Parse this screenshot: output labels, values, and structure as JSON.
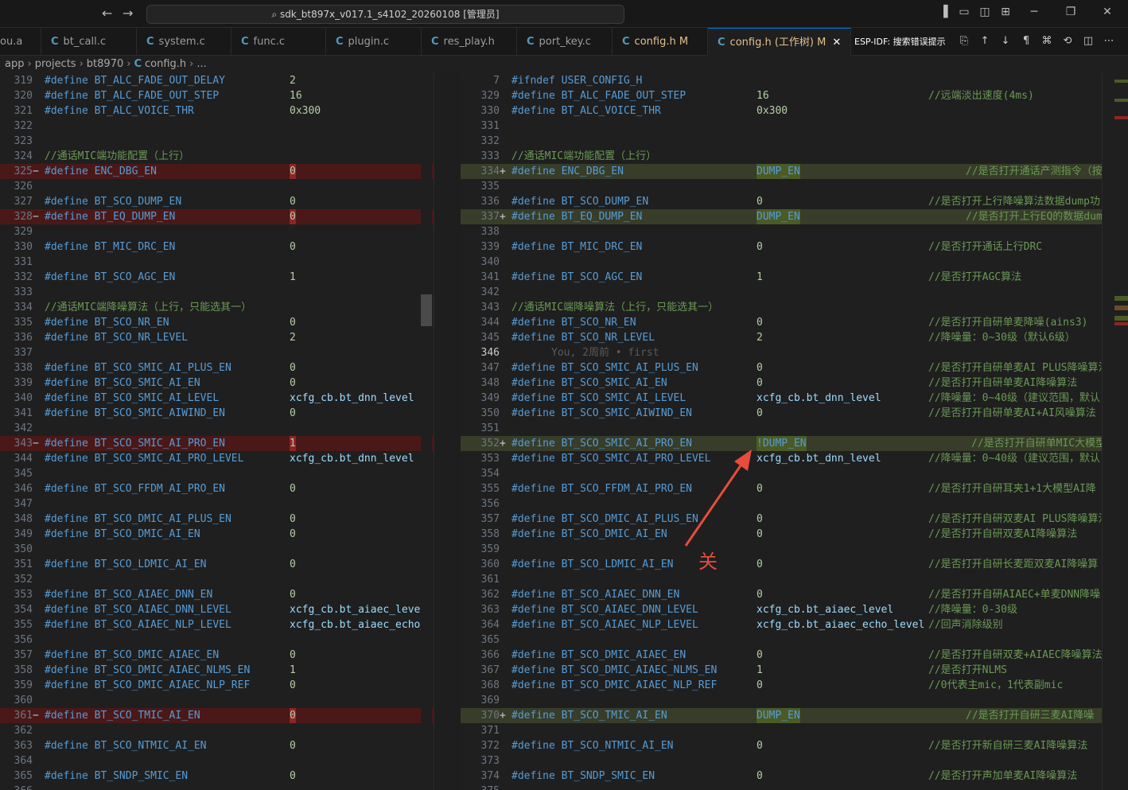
{
  "titlebar": {
    "back_icon": "arrow-left-icon",
    "forward_icon": "arrow-right-icon",
    "search_text": "sdk_bt897x_v017.1_s4102_20260108 [管理员]",
    "controls": [
      "layout-sidebar-icon",
      "layout-panel-icon",
      "layout-split-icon",
      "layout-grid-icon",
      "minimize-icon",
      "restore-icon",
      "close-icon"
    ]
  },
  "tabs": [
    {
      "label": "ou.a",
      "icon": "",
      "mod": "",
      "active": false
    },
    {
      "label": "bt_call.c",
      "icon": "C",
      "mod": "",
      "active": false
    },
    {
      "label": "system.c",
      "icon": "C",
      "mod": "",
      "active": false
    },
    {
      "label": "func.c",
      "icon": "C",
      "mod": "",
      "active": false
    },
    {
      "label": "plugin.c",
      "icon": "C",
      "mod": "",
      "active": false
    },
    {
      "label": "res_play.h",
      "icon": "C",
      "mod": "",
      "active": false
    },
    {
      "label": "port_key.c",
      "icon": "C",
      "mod": "",
      "active": false
    },
    {
      "label": "config.h",
      "icon": "C",
      "mod": "M",
      "active": false
    },
    {
      "label": "config.h (工作树)",
      "icon": "C",
      "mod": "M",
      "active": true
    }
  ],
  "tab_tools": {
    "label": "ESP-IDF: 搜索错误提示"
  },
  "breadcrumb": [
    "app",
    "projects",
    "bt8970",
    "config.h",
    "..."
  ],
  "colors": {
    "deleted": "#4b1818",
    "added": "#373d29",
    "keyword": "#569cd6",
    "comment": "#6a9955",
    "number": "#b5cea8",
    "annotation": "#e74c3c"
  },
  "left_lines": [
    {
      "n": "319",
      "t": "d",
      "name": "BT_ALC_FADE_OUT_DELAY",
      "val": "2"
    },
    {
      "n": "320",
      "t": "d",
      "name": "BT_ALC_FADE_OUT_STEP",
      "val": "16"
    },
    {
      "n": "321",
      "t": "d",
      "name": "BT_ALC_VOICE_THR",
      "val": "0x300"
    },
    {
      "n": "322",
      "t": "e"
    },
    {
      "n": "323",
      "t": "e"
    },
    {
      "n": "324",
      "t": "c",
      "text": "//通话MIC端功能配置（上行）"
    },
    {
      "n": "325",
      "t": "d",
      "name": "ENC_DBG_EN",
      "val": "0",
      "diff": "del"
    },
    {
      "n": "326",
      "t": "e"
    },
    {
      "n": "327",
      "t": "d",
      "name": "BT_SCO_DUMP_EN",
      "val": "0"
    },
    {
      "n": "328",
      "t": "d",
      "name": "BT_EQ_DUMP_EN",
      "val": "0",
      "diff": "del"
    },
    {
      "n": "329",
      "t": "e"
    },
    {
      "n": "330",
      "t": "d",
      "name": "BT_MIC_DRC_EN",
      "val": "0"
    },
    {
      "n": "331",
      "t": "e"
    },
    {
      "n": "332",
      "t": "d",
      "name": "BT_SCO_AGC_EN",
      "val": "1"
    },
    {
      "n": "333",
      "t": "e"
    },
    {
      "n": "334",
      "t": "c",
      "text": "//通话MIC端降噪算法（上行，只能选其一）"
    },
    {
      "n": "335",
      "t": "d",
      "name": "BT_SCO_NR_EN",
      "val": "0"
    },
    {
      "n": "336",
      "t": "d",
      "name": "BT_SCO_NR_LEVEL",
      "val": "2"
    },
    {
      "n": "337",
      "t": "e"
    },
    {
      "n": "338",
      "t": "d",
      "name": "BT_SCO_SMIC_AI_PLUS_EN",
      "val": "0"
    },
    {
      "n": "339",
      "t": "d",
      "name": "BT_SCO_SMIC_AI_EN",
      "val": "0"
    },
    {
      "n": "340",
      "t": "d",
      "name": "BT_SCO_SMIC_AI_LEVEL",
      "val": "xcfg_cb.bt_dnn_level"
    },
    {
      "n": "341",
      "t": "d",
      "name": "BT_SCO_SMIC_AIWIND_EN",
      "val": "0"
    },
    {
      "n": "342",
      "t": "e"
    },
    {
      "n": "343",
      "t": "d",
      "name": "BT_SCO_SMIC_AI_PRO_EN",
      "val": "1",
      "diff": "del"
    },
    {
      "n": "344",
      "t": "d",
      "name": "BT_SCO_SMIC_AI_PRO_LEVEL",
      "val": "xcfg_cb.bt_dnn_level"
    },
    {
      "n": "345",
      "t": "e"
    },
    {
      "n": "346",
      "t": "d",
      "name": "BT_SCO_FFDM_AI_PRO_EN",
      "val": "0"
    },
    {
      "n": "347",
      "t": "e"
    },
    {
      "n": "348",
      "t": "d",
      "name": "BT_SCO_DMIC_AI_PLUS_EN",
      "val": "0"
    },
    {
      "n": "349",
      "t": "d",
      "name": "BT_SCO_DMIC_AI_EN",
      "val": "0"
    },
    {
      "n": "350",
      "t": "e"
    },
    {
      "n": "351",
      "t": "d",
      "name": "BT_SCO_LDMIC_AI_EN",
      "val": "0"
    },
    {
      "n": "352",
      "t": "e"
    },
    {
      "n": "353",
      "t": "d",
      "name": "BT_SCO_AIAEC_DNN_EN",
      "val": "0"
    },
    {
      "n": "354",
      "t": "d",
      "name": "BT_SCO_AIAEC_DNN_LEVEL",
      "val": "xcfg_cb.bt_aiaec_level"
    },
    {
      "n": "355",
      "t": "d",
      "name": "BT_SCO_AIAEC_NLP_LEVEL",
      "val": "xcfg_cb.bt_aiaec_echo_l"
    },
    {
      "n": "356",
      "t": "e"
    },
    {
      "n": "357",
      "t": "d",
      "name": "BT_SCO_DMIC_AIAEC_EN",
      "val": "0"
    },
    {
      "n": "358",
      "t": "d",
      "name": "BT_SCO_DMIC_AIAEC_NLMS_EN",
      "val": "1"
    },
    {
      "n": "359",
      "t": "d",
      "name": "BT_SCO_DMIC_AIAEC_NLP_REF",
      "val": "0"
    },
    {
      "n": "360",
      "t": "e"
    },
    {
      "n": "361",
      "t": "d",
      "name": "BT_SCO_TMIC_AI_EN",
      "val": "0",
      "diff": "del"
    },
    {
      "n": "362",
      "t": "e"
    },
    {
      "n": "363",
      "t": "d",
      "name": "BT_SCO_NTMIC_AI_EN",
      "val": "0"
    },
    {
      "n": "364",
      "t": "e"
    },
    {
      "n": "365",
      "t": "d",
      "name": "BT_SNDP_SMIC_EN",
      "val": "0"
    },
    {
      "n": "366",
      "t": "e"
    }
  ],
  "right_lines": [
    {
      "n": "7",
      "t": "raw",
      "text": "#ifndef USER_CONFIG_H"
    },
    {
      "n": "329",
      "t": "d",
      "name": "BT_ALC_FADE_OUT_STEP",
      "val": "16",
      "cmt": "//远端淡出速度(4ms)"
    },
    {
      "n": "330",
      "t": "d",
      "name": "BT_ALC_VOICE_THR",
      "val": "0x300"
    },
    {
      "n": "331",
      "t": "e"
    },
    {
      "n": "332",
      "t": "e"
    },
    {
      "n": "333",
      "t": "c",
      "text": "//通话MIC端功能配置（上行）"
    },
    {
      "n": "334",
      "t": "d",
      "name": "ENC_DBG_EN",
      "val": "DUMP_EN",
      "cmt": "//是否打开通话产测指令（按",
      "diff": "add",
      "cmtAt": "far"
    },
    {
      "n": "335",
      "t": "e"
    },
    {
      "n": "336",
      "t": "d",
      "name": "BT_SCO_DUMP_EN",
      "val": "0",
      "cmt": "//是否打开上行降噪算法数据dump功"
    },
    {
      "n": "337",
      "t": "d",
      "name": "BT_EQ_DUMP_EN",
      "val": "DUMP_EN",
      "cmt": "//是否打开上行EQ的数据dump",
      "diff": "add",
      "cmtAt": "far"
    },
    {
      "n": "338",
      "t": "e"
    },
    {
      "n": "339",
      "t": "d",
      "name": "BT_MIC_DRC_EN",
      "val": "0",
      "cmt": "//是否打开通话上行DRC"
    },
    {
      "n": "340",
      "t": "e"
    },
    {
      "n": "341",
      "t": "d",
      "name": "BT_SCO_AGC_EN",
      "val": "1",
      "cmt": "//是否打开AGC算法"
    },
    {
      "n": "342",
      "t": "e"
    },
    {
      "n": "343",
      "t": "c",
      "text": "//通话MIC端降噪算法（上行，只能选其一）"
    },
    {
      "n": "344",
      "t": "d",
      "name": "BT_SCO_NR_EN",
      "val": "0",
      "cmt": "//是否打开自研单麦降噪(ains3)"
    },
    {
      "n": "345",
      "t": "d",
      "name": "BT_SCO_NR_LEVEL",
      "val": "2",
      "cmt": "//降噪量：0~30级（默认6级）"
    },
    {
      "n": "346",
      "t": "blame",
      "text": "You, 2周前 • first",
      "cur": true
    },
    {
      "n": "347",
      "t": "d",
      "name": "BT_SCO_SMIC_AI_PLUS_EN",
      "val": "0",
      "cmt": "//是否打开自研单麦AI PLUS降噪算法"
    },
    {
      "n": "348",
      "t": "d",
      "name": "BT_SCO_SMIC_AI_EN",
      "val": "0",
      "cmt": "//是否打开自研单麦AI降噪算法"
    },
    {
      "n": "349",
      "t": "d",
      "name": "BT_SCO_SMIC_AI_LEVEL",
      "val": "xcfg_cb.bt_dnn_level",
      "cmt": "//降噪量：0~40级（建议范围，默认"
    },
    {
      "n": "350",
      "t": "d",
      "name": "BT_SCO_SMIC_AIWIND_EN",
      "val": "0",
      "cmt": "//是否打开自研单麦AI+AI风噪算法"
    },
    {
      "n": "351",
      "t": "e"
    },
    {
      "n": "352",
      "t": "d",
      "name": "BT_SCO_SMIC_AI_PRO_EN",
      "val": "!DUMP_EN",
      "cmt": "//是否打开自研单MIC大模型",
      "diff": "add",
      "cmtAt": "far2"
    },
    {
      "n": "353",
      "t": "d",
      "name": "BT_SCO_SMIC_AI_PRO_LEVEL",
      "val": "xcfg_cb.bt_dnn_level",
      "cmt": "//降噪量：0~40级（建议范围，默认"
    },
    {
      "n": "354",
      "t": "e"
    },
    {
      "n": "355",
      "t": "d",
      "name": "BT_SCO_FFDM_AI_PRO_EN",
      "val": "0",
      "cmt": "//是否打开自研耳夹1+1大模型AI降"
    },
    {
      "n": "356",
      "t": "e"
    },
    {
      "n": "357",
      "t": "d",
      "name": "BT_SCO_DMIC_AI_PLUS_EN",
      "val": "0",
      "cmt": "//是否打开自研双麦AI PLUS降噪算法"
    },
    {
      "n": "358",
      "t": "d",
      "name": "BT_SCO_DMIC_AI_EN",
      "val": "0",
      "cmt": "//是否打开自研双麦AI降噪算法"
    },
    {
      "n": "359",
      "t": "e"
    },
    {
      "n": "360",
      "t": "d",
      "name": "BT_SCO_LDMIC_AI_EN",
      "val": "0",
      "cmt": "//是否打开自研长麦距双麦AI降噪算"
    },
    {
      "n": "361",
      "t": "e"
    },
    {
      "n": "362",
      "t": "d",
      "name": "BT_SCO_AIAEC_DNN_EN",
      "val": "0",
      "cmt": "//是否打开自研AIAEC+单麦DNN降噪"
    },
    {
      "n": "363",
      "t": "d",
      "name": "BT_SCO_AIAEC_DNN_LEVEL",
      "val": "xcfg_cb.bt_aiaec_level",
      "cmt": "//降噪量：0-30级"
    },
    {
      "n": "364",
      "t": "d",
      "name": "BT_SCO_AIAEC_NLP_LEVEL",
      "val": "xcfg_cb.bt_aiaec_echo_level",
      "cmt": "//回声消除级别"
    },
    {
      "n": "365",
      "t": "e"
    },
    {
      "n": "366",
      "t": "d",
      "name": "BT_SCO_DMIC_AIAEC_EN",
      "val": "0",
      "cmt": "//是否打开自研双麦+AIAEC降噪算法"
    },
    {
      "n": "367",
      "t": "d",
      "name": "BT_SCO_DMIC_AIAEC_NLMS_EN",
      "val": "1",
      "cmt": "//是否打开NLMS"
    },
    {
      "n": "368",
      "t": "d",
      "name": "BT_SCO_DMIC_AIAEC_NLP_REF",
      "val": "0",
      "cmt": "//0代表主mic，1代表副mic"
    },
    {
      "n": "369",
      "t": "e"
    },
    {
      "n": "370",
      "t": "d",
      "name": "BT_SCO_TMIC_AI_EN",
      "val": "DUMP_EN",
      "cmt": "//是否打开自研三麦AI降噪",
      "diff": "add",
      "cmtAt": "far"
    },
    {
      "n": "371",
      "t": "e"
    },
    {
      "n": "372",
      "t": "d",
      "name": "BT_SCO_NTMIC_AI_EN",
      "val": "0",
      "cmt": "//是否打开新自研三麦AI降噪算法"
    },
    {
      "n": "373",
      "t": "e"
    },
    {
      "n": "374",
      "t": "d",
      "name": "BT_SNDP_SMIC_EN",
      "val": "0",
      "cmt": "//是否打开声加单麦AI降噪算法"
    },
    {
      "n": "375",
      "t": "e"
    }
  ],
  "annotation": {
    "text": "关"
  }
}
